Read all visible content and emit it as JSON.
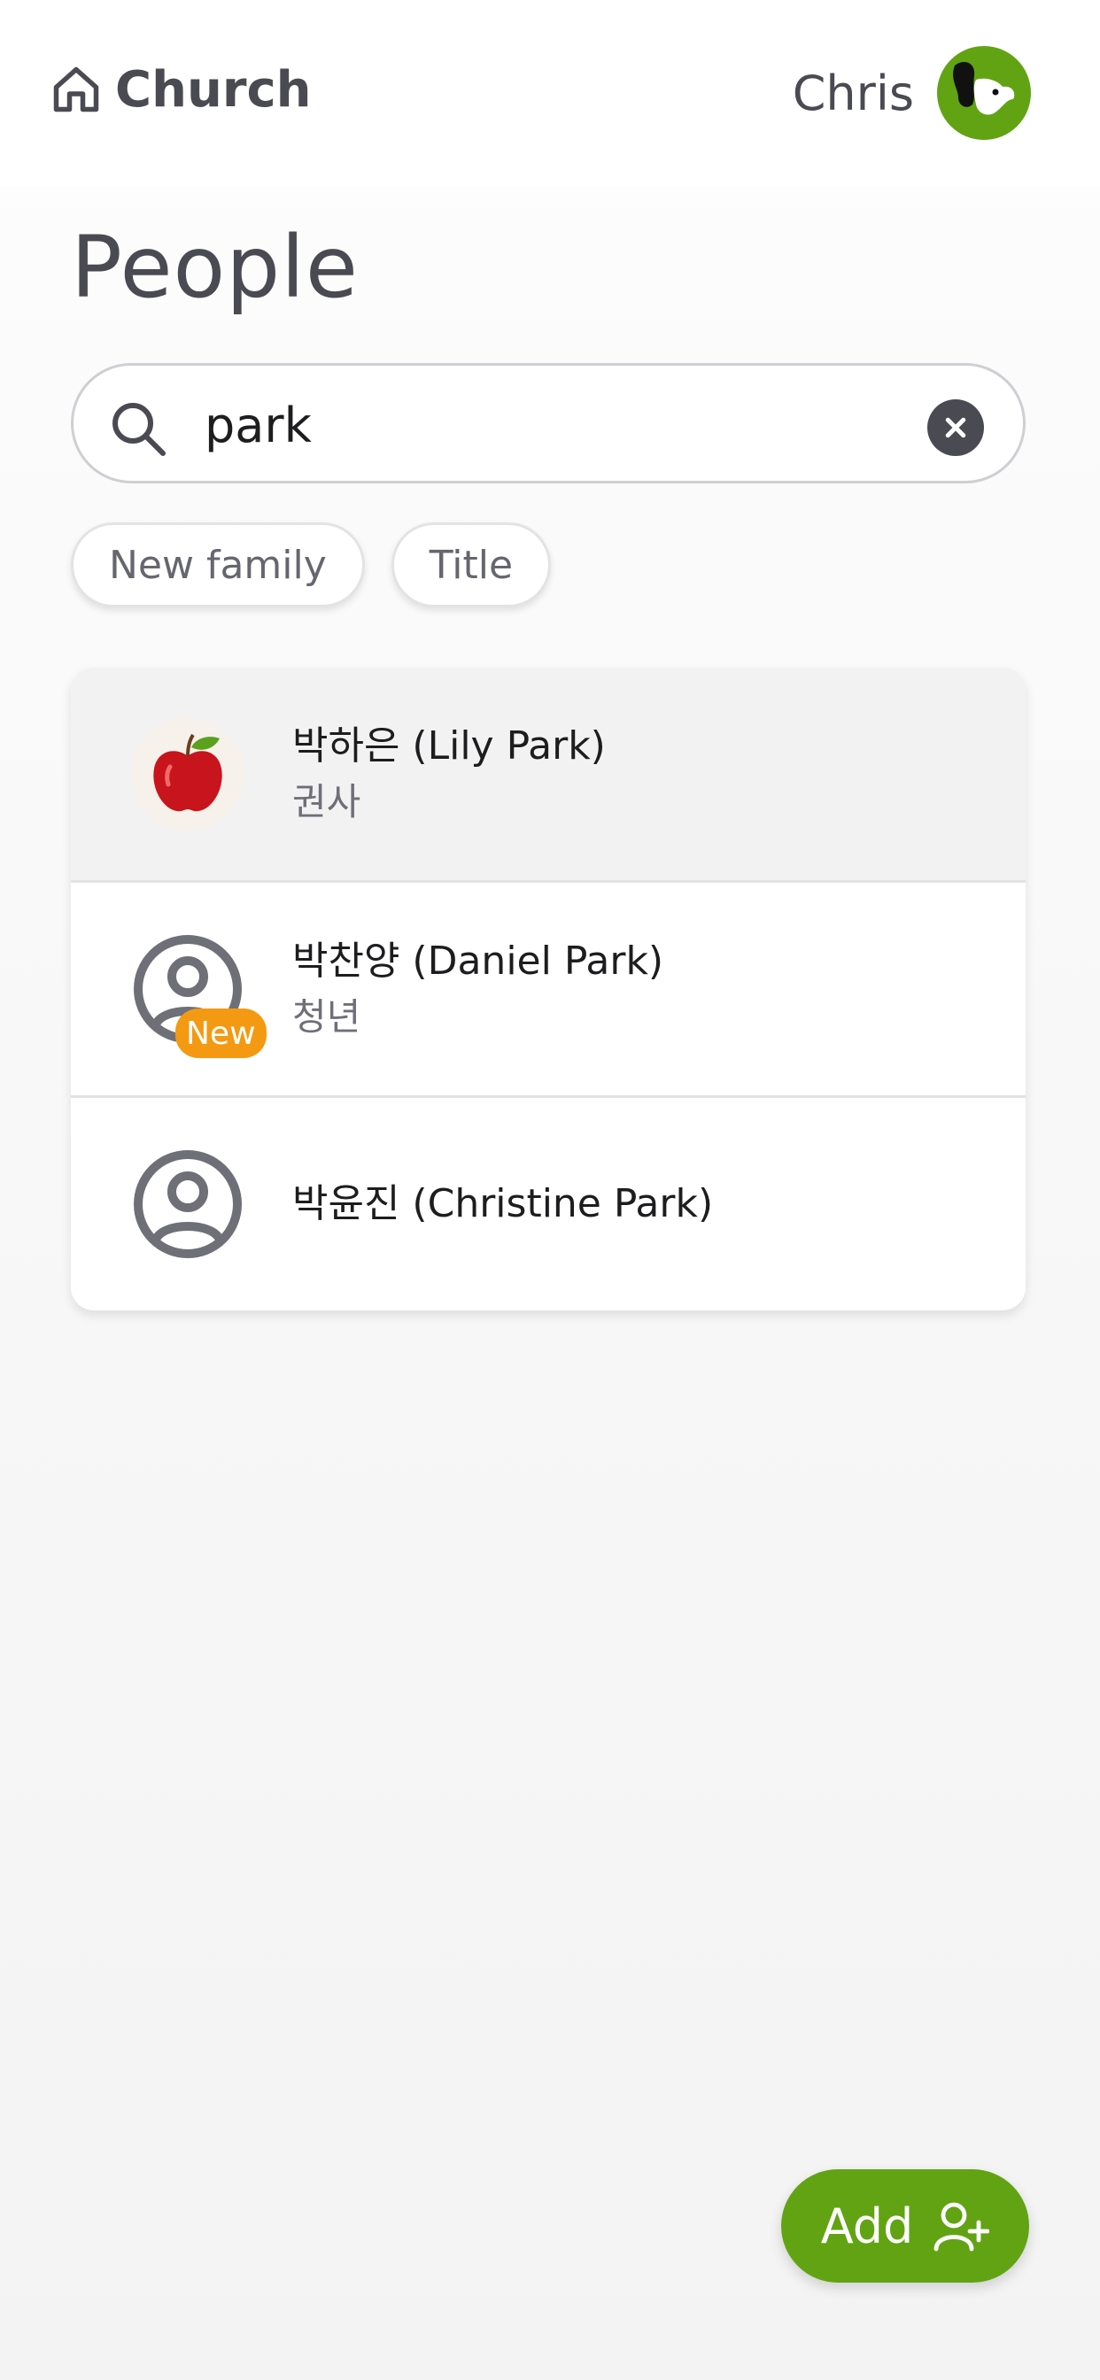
{
  "header": {
    "brand": "Church",
    "home_icon": "home-icon",
    "user_name": "Chris",
    "avatar_icon": "bird-avatar",
    "avatar_color": "#62a313"
  },
  "page": {
    "title": "People"
  },
  "search": {
    "value": "park",
    "placeholder": "",
    "icon": "search-icon",
    "clear_icon": "clear-icon"
  },
  "filters": [
    {
      "label": "New family"
    },
    {
      "label": "Title"
    }
  ],
  "people": [
    {
      "name": "박하은 (Lily Park)",
      "title": "권사",
      "avatar": "apple-photo",
      "badge": "",
      "selected": true
    },
    {
      "name": "박찬양 (Daniel Park)",
      "title": "청년",
      "avatar": "person-icon",
      "badge": "New",
      "selected": false
    },
    {
      "name": "박윤진 (Christine Park)",
      "title": "",
      "avatar": "person-icon",
      "badge": "",
      "selected": false
    }
  ],
  "colors": {
    "accent": "#62a313",
    "badge": "#f39a12",
    "text_muted": "#4a4a52"
  },
  "add_button": {
    "label": "Add",
    "icon": "add-person-icon"
  }
}
